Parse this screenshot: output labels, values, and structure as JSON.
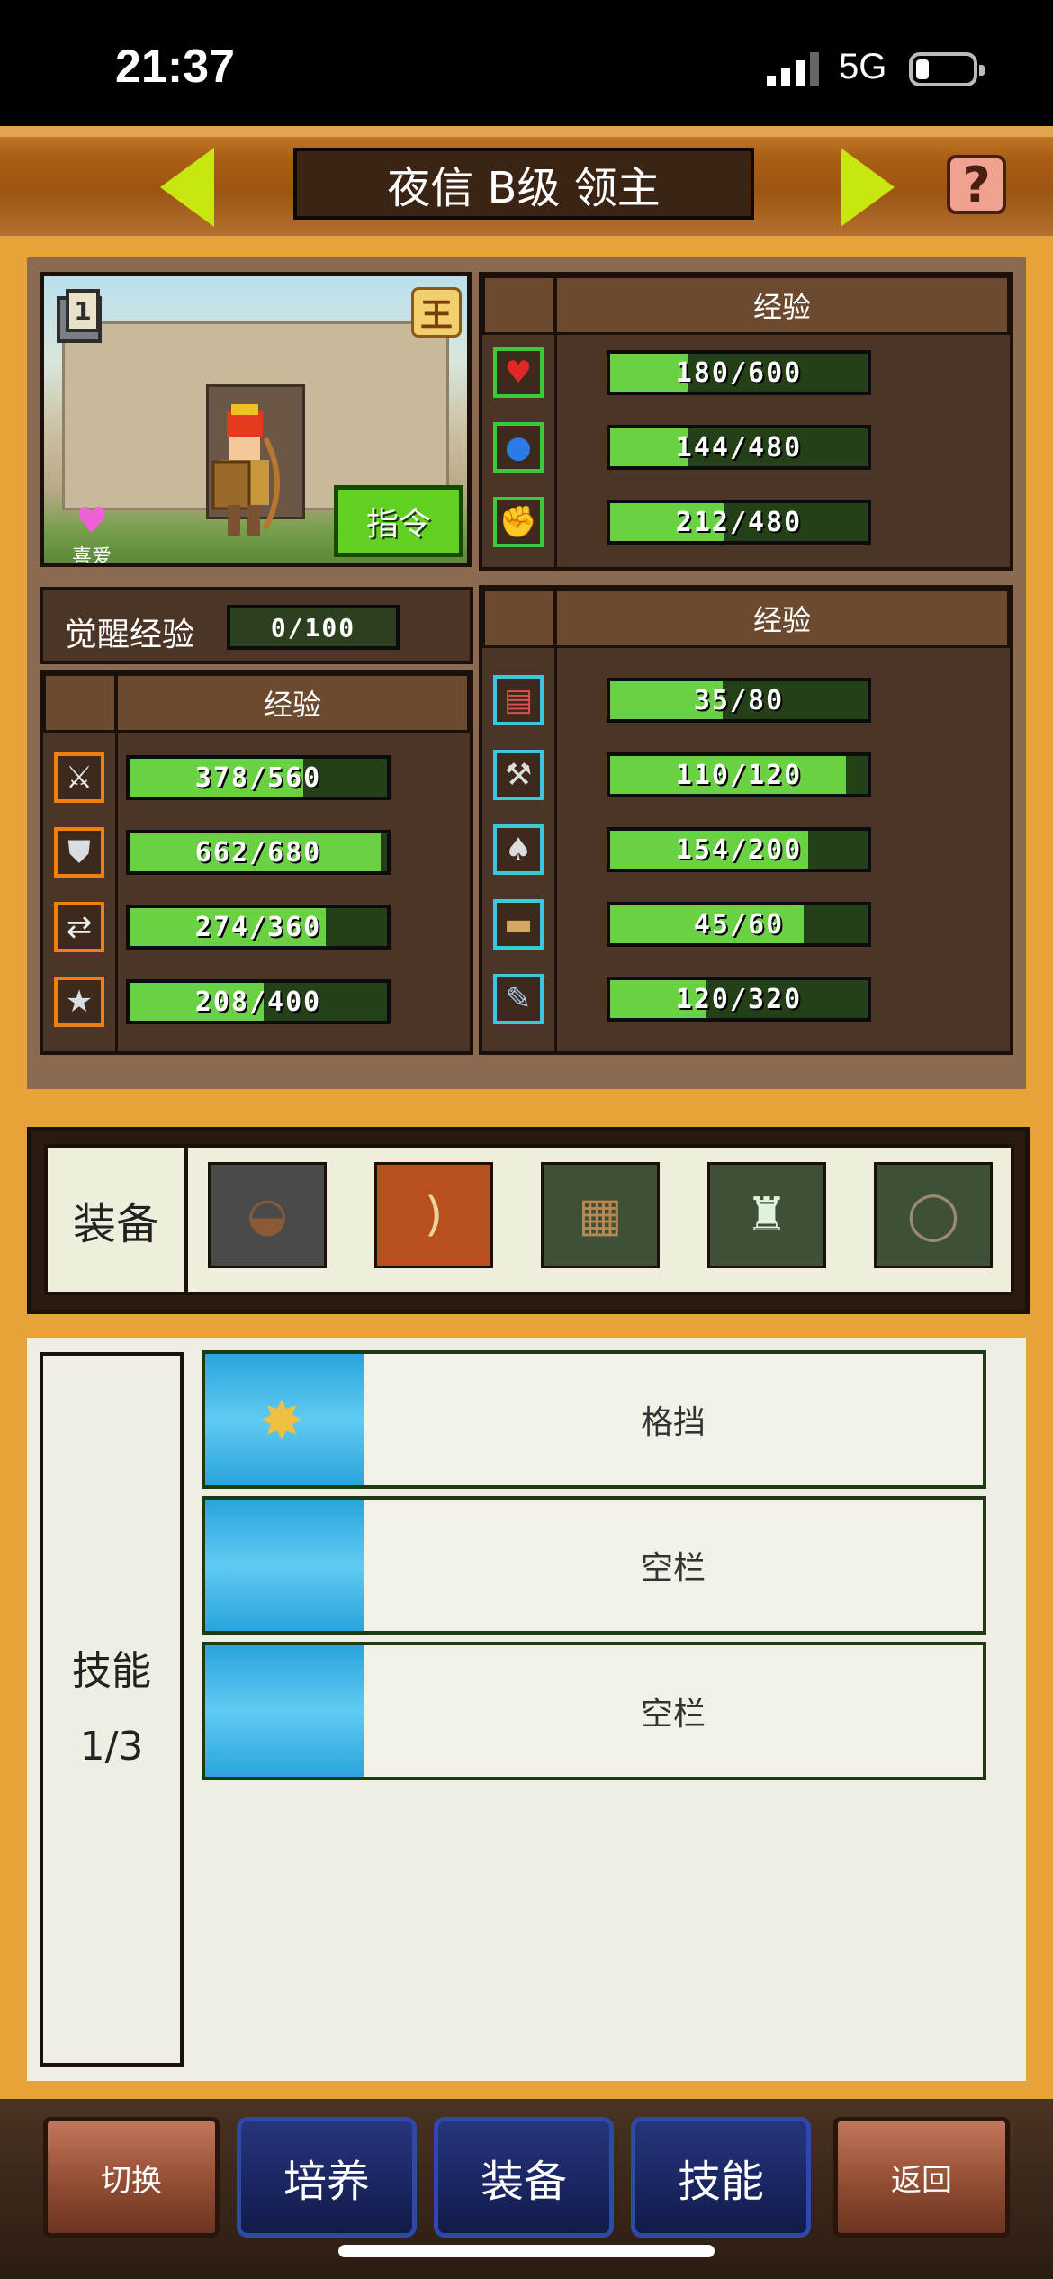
{
  "status_bar": {
    "time": "21:37",
    "network": "5G"
  },
  "header": {
    "title": "夜信 B级 领主",
    "help_icon": "question-icon"
  },
  "portrait": {
    "rank_icon": "rank-1-icon",
    "king_badge": "王",
    "like_label": "喜爱",
    "command_label": "指令"
  },
  "awaken": {
    "label": "觉醒经验",
    "value": "0/100",
    "progress": 0.0
  },
  "vitals": {
    "header": "经验",
    "rows": [
      {
        "icon": "heart-icon",
        "text": "180/600",
        "progress": 0.3
      },
      {
        "icon": "potion-icon",
        "text": "144/480",
        "progress": 0.3
      },
      {
        "icon": "strength-icon",
        "text": "212/480",
        "progress": 0.442
      }
    ]
  },
  "combat_stats": {
    "header": "经验",
    "rows": [
      {
        "icon": "sword-icon",
        "text": "378/560",
        "progress": 0.675
      },
      {
        "icon": "shield-icon",
        "text": "662/680",
        "progress": 0.974
      },
      {
        "icon": "speed-arrows-icon",
        "text": "274/360",
        "progress": 0.761
      },
      {
        "icon": "star-icon",
        "text": "208/400",
        "progress": 0.52
      }
    ]
  },
  "work_stats": {
    "header": "经验",
    "rows": [
      {
        "icon": "book-icon",
        "text": "35/80",
        "progress": 0.4375
      },
      {
        "icon": "hammer-icon",
        "text": "110/120",
        "progress": 0.917
      },
      {
        "icon": "shovel-icon",
        "text": "154/200",
        "progress": 0.77
      },
      {
        "icon": "bed-icon",
        "text": "45/60",
        "progress": 0.75
      },
      {
        "icon": "scroll-icon",
        "text": "120/320",
        "progress": 0.375
      }
    ]
  },
  "equipment": {
    "label": "装备",
    "slots": [
      {
        "icon": "leather-helmet-icon",
        "bg": "#4a4a4a"
      },
      {
        "icon": "bow-icon",
        "bg": "#b8501e"
      },
      {
        "icon": "wooden-shield-icon",
        "bg": "#3e5036"
      },
      {
        "icon": "green-robe-icon",
        "bg": "#3e5036"
      },
      {
        "icon": "ring-icon",
        "bg": "#3e5036"
      }
    ]
  },
  "skills": {
    "label": "技能",
    "count": "1/3",
    "slots": [
      {
        "name": "格挡",
        "icon": "block-skill-icon"
      },
      {
        "name": "空栏",
        "icon": ""
      },
      {
        "name": "空栏",
        "icon": ""
      }
    ]
  },
  "nav": {
    "switch": "切换",
    "train": "培养",
    "equip": "装备",
    "skill": "技能",
    "back": "返回"
  },
  "colors": {
    "accent_orange": "#e8a23a",
    "bar_fill": "#6ad044",
    "bar_empty": "#244019",
    "arrow_green": "#c8e60f",
    "skill_blue": "#5fcbf2"
  }
}
